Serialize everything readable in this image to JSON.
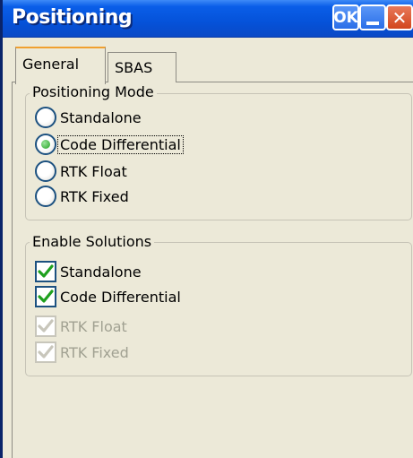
{
  "window": {
    "title": "Positioning",
    "ok_label": "OK",
    "close_glyph": "✕"
  },
  "tabs": [
    {
      "label": "General",
      "active": true
    },
    {
      "label": "SBAS",
      "active": false
    }
  ],
  "positioning_mode": {
    "title": "Positioning Mode",
    "options": [
      {
        "label": "Standalone",
        "selected": false
      },
      {
        "label": "Code Differential",
        "selected": true
      },
      {
        "label": "RTK Float",
        "selected": false
      },
      {
        "label": "RTK Fixed",
        "selected": false
      }
    ]
  },
  "enable_solutions": {
    "title": "Enable Solutions",
    "options": [
      {
        "label": "Standalone",
        "checked": true,
        "enabled": true
      },
      {
        "label": "Code Differential",
        "checked": true,
        "enabled": true
      },
      {
        "label": "RTK Float",
        "checked": true,
        "enabled": false
      },
      {
        "label": "RTK Fixed",
        "checked": true,
        "enabled": false
      }
    ]
  },
  "colors": {
    "titlebar": "#0552d9",
    "check_enabled": "#1ea01e",
    "check_disabled": "#c8c6bb",
    "text_disabled": "#a1a192"
  }
}
